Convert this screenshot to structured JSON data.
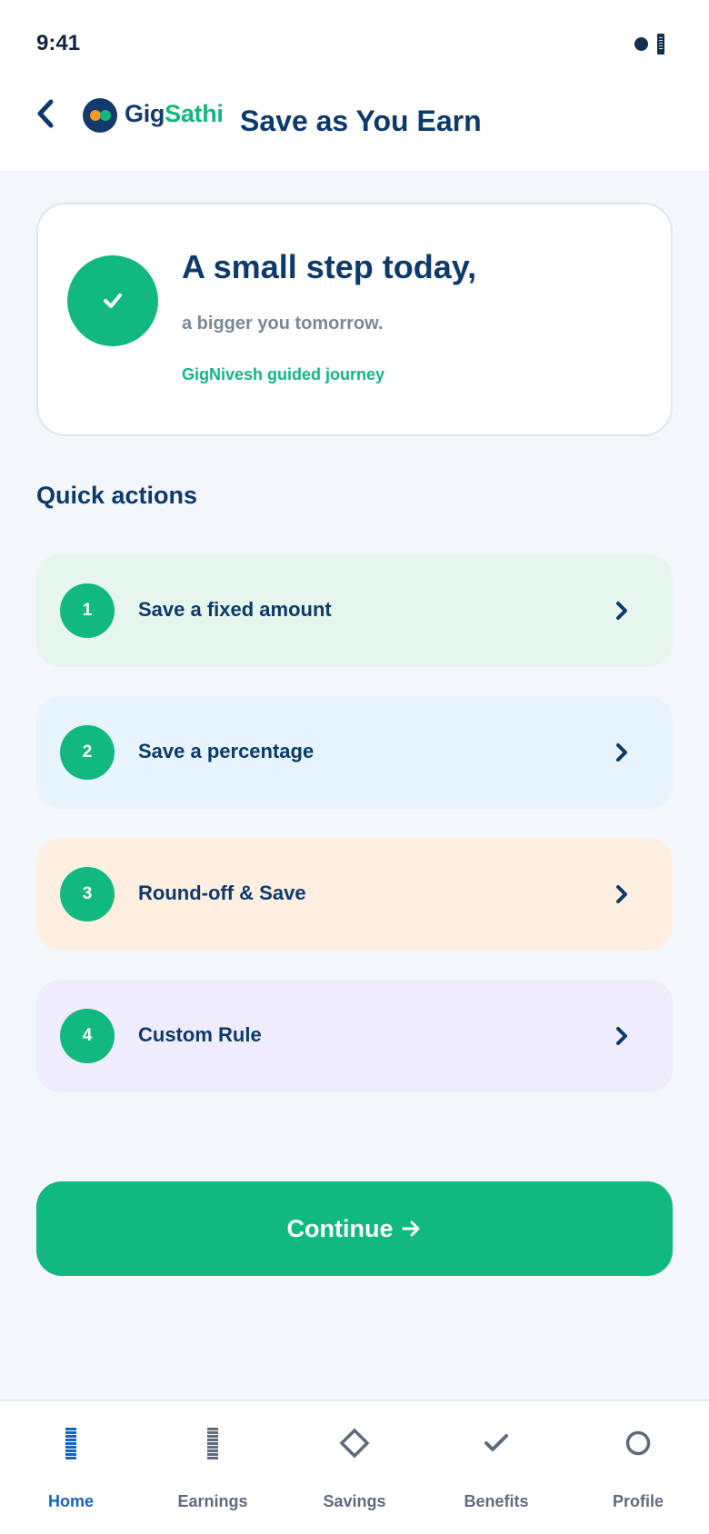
{
  "status_bar": {
    "time": "9:41"
  },
  "header": {
    "brand_part1": "Gig",
    "brand_part2": "Sathi",
    "title": "Save as You Earn"
  },
  "hero": {
    "title": "A small step today,",
    "subtitle": "a bigger you tomorrow.",
    "tag": "GigNivesh guided journey",
    "icon": "check-icon"
  },
  "quick_actions": {
    "title": "Quick actions",
    "items": [
      {
        "number": "1",
        "label": "Save a fixed amount",
        "bg": "#e6f6ee"
      },
      {
        "number": "2",
        "label": "Save a percentage",
        "bg": "#e7f3fd"
      },
      {
        "number": "3",
        "label": "Round-off & Save",
        "bg": "#ffefe1"
      },
      {
        "number": "4",
        "label": "Custom Rule",
        "bg": "#efecfd"
      }
    ]
  },
  "continue_label": "Continue",
  "colors": {
    "primary": "#11b87f",
    "navy": "#0b3a6b",
    "active_nav": "#1565c0"
  },
  "bottom_nav": [
    {
      "label": "Home",
      "icon": "home-icon",
      "active": true
    },
    {
      "label": "Earnings",
      "icon": "earnings-icon",
      "active": false
    },
    {
      "label": "Savings",
      "icon": "diamond-icon",
      "active": false
    },
    {
      "label": "Benefits",
      "icon": "check-icon",
      "active": false
    },
    {
      "label": "Profile",
      "icon": "circle-icon",
      "active": false
    }
  ]
}
